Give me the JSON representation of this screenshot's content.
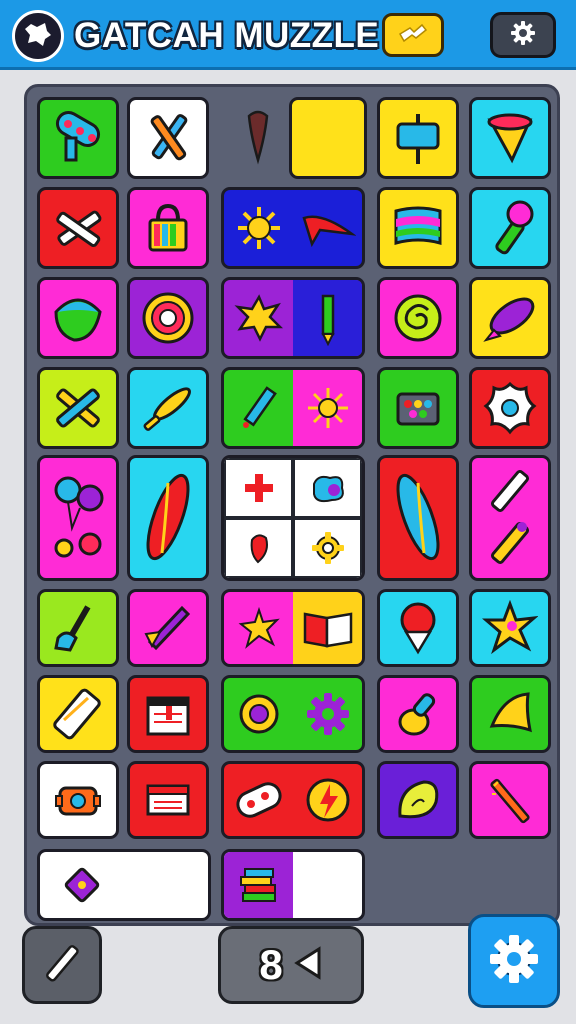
{
  "header": {
    "title": "GATCAH MUZZLE",
    "logo_icon": "splat-logo-icon",
    "ticket_icon": "ticket-icon",
    "settings_icon": "gear-icon"
  },
  "controls": {
    "pen_icon": "pencil-icon",
    "undo_label": "8",
    "undo_icon": "back-triangle-icon",
    "settings_icon": "gear-icon"
  },
  "board": {
    "rows": [
      [
        {
          "bg": "#2ecc1f",
          "icon": "palette-icon"
        },
        {
          "bg": "#ffffff",
          "icon": "crossed-tools-icon"
        },
        {
          "bg": "#5b6174",
          "icon": "paint-drop-icon",
          "empty": true
        },
        {
          "bg": "#ffe11a",
          "icon": "blank"
        },
        {
          "bg": "#ffe11a",
          "icon": "sign-board-icon"
        },
        {
          "bg": "#28d6f0",
          "icon": "paint-cup-icon"
        }
      ],
      [
        {
          "bg": "#ee1f24",
          "icon": "crossed-brush-icon"
        },
        {
          "bg": "#ff2bd6",
          "icon": "paint-bag-icon"
        },
        {
          "bg": "#1b1fd8",
          "icon": "sun-and-kite-icon",
          "wide": true
        },
        {
          "bg": "#ffe11a",
          "icon": "rainbow-flag-icon"
        },
        {
          "bg": "#28d6f0",
          "icon": "microphone-brush-icon"
        }
      ],
      [
        {
          "bg": "#ff2bd6",
          "icon": "shell-icon"
        },
        {
          "bg": "#9c23d6",
          "icon": "donut-icon"
        },
        {
          "bg": "#9c23d6",
          "icon": "splat-and-pencil-icon",
          "wide": true
        },
        {
          "bg": "#ff2bd6",
          "icon": "swirl-icon"
        },
        {
          "bg": "#ffe11a",
          "icon": "rocket-icon"
        }
      ],
      [
        {
          "bg": "#c6ee19",
          "icon": "cross-tools-icon"
        },
        {
          "bg": "#28d6f0",
          "icon": "baseball-bat-icon"
        },
        {
          "bg": "#2ecc1f",
          "icon": "pencil-and-sun-icon",
          "wide": true
        },
        {
          "bg": "#2ecc1f",
          "icon": "paint-box-icon"
        },
        {
          "bg": "#ee1f24",
          "icon": "flower-badge-icon"
        }
      ],
      [
        {
          "bg": "#ff2bd6",
          "icon": "balloons-icon"
        },
        {
          "bg": "#28d6f0",
          "icon": "surfboard-icon"
        },
        {
          "bg": "#ffffff",
          "icon": "grid-of-four-icon",
          "wide": true
        },
        {
          "bg": "#ee1f24",
          "icon": "surfboard-icon"
        },
        {
          "bg": "#ff2bd6",
          "icon": "crayons-icon"
        }
      ],
      [
        {
          "bg": "#9ae81f",
          "icon": "plunger-icon"
        },
        {
          "bg": "#ff2bd6",
          "icon": "arrow-rocket-icon"
        },
        {
          "bg": "#ff2bd6",
          "icon": "star-and-book-icon",
          "wide": true
        },
        {
          "bg": "#28d6f0",
          "icon": "balloon-icon"
        },
        {
          "bg": "#28d6f0",
          "icon": "star-icon"
        }
      ],
      [
        {
          "bg": "#ffe11a",
          "icon": "eraser-icon"
        },
        {
          "bg": "#ee1f24",
          "icon": "calendar-icon"
        },
        {
          "bg": "#2ecc1f",
          "icon": "ring-and-gear-icon",
          "wide": true
        },
        {
          "bg": "#ff2bd6",
          "icon": "bulb-icon"
        },
        {
          "bg": "#2ecc1f",
          "icon": "horn-icon"
        }
      ],
      [
        {
          "bg": "#ffffff",
          "icon": "cog-icon"
        },
        {
          "bg": "#ee1f24",
          "icon": "book-stack-icon"
        },
        {
          "bg": "#ee1f24",
          "icon": "pill-and-bolt-icon",
          "wide": true
        },
        {
          "bg": "#6a1fd8",
          "icon": "lemon-icon"
        },
        {
          "bg": "#ff2bd6",
          "icon": "wand-icon"
        }
      ],
      [
        {
          "bg": "#ffffff",
          "icon": "tag-icon",
          "wide": true
        },
        {
          "bg": "#ffffff",
          "icon": "books-icon",
          "wide": true
        }
      ]
    ]
  }
}
